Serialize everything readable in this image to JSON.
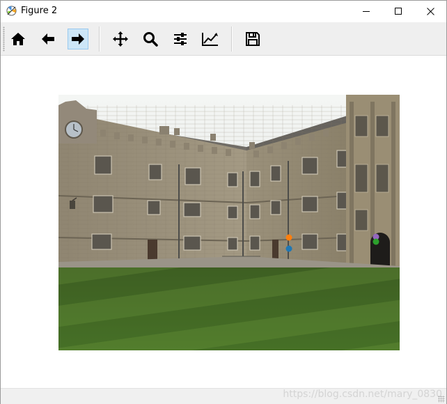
{
  "window": {
    "title": "Figure 2"
  },
  "toolbar": {
    "tools": [
      {
        "icon": "home-icon",
        "active": false
      },
      {
        "icon": "back-arrow-icon",
        "active": false
      },
      {
        "icon": "forward-arrow-icon",
        "active": true
      },
      {
        "icon": "pan-icon",
        "active": false
      },
      {
        "icon": "zoom-icon",
        "active": false
      },
      {
        "icon": "subplots-sliders-icon",
        "active": false
      },
      {
        "icon": "edit-axis-icon",
        "active": false
      },
      {
        "icon": "save-icon",
        "active": false
      }
    ]
  },
  "figure": {
    "image": "photo of stone college building and striped lawn quad",
    "markers": [
      {
        "color": "#ff7f0e",
        "label": "orange point"
      },
      {
        "color": "#1f77b4",
        "label": "blue point"
      },
      {
        "color": "#9467bd",
        "label": "purple point"
      },
      {
        "color": "#2ca02c",
        "label": "green point"
      }
    ]
  },
  "statusbar": {
    "watermark": "https://blog.csdn.net/mary_0830"
  }
}
